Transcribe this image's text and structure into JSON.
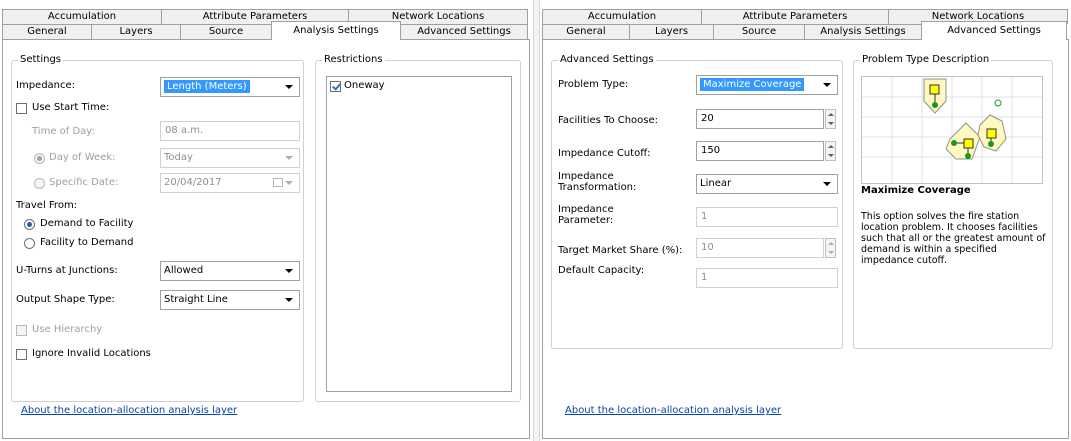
{
  "left": {
    "tabs_row1": [
      "Accumulation",
      "Attribute Parameters",
      "Network Locations"
    ],
    "tabs_row2": [
      "General",
      "Layers",
      "Source",
      "Analysis Settings",
      "Advanced Settings"
    ],
    "active_tab": "Analysis Settings",
    "settings_legend": "Settings",
    "impedance_label": "Impedance:",
    "impedance_value": "Length (Meters)",
    "use_start_time_label": "Use Start Time:",
    "time_of_day_label": "Time of Day:",
    "time_of_day_value": "08 a.m.",
    "day_of_week_label": "Day of Week:",
    "day_of_week_value": "Today",
    "specific_date_label": "Specific Date:",
    "specific_date_value": "20/04/2017",
    "travel_from_label": "Travel From:",
    "demand_to_facility": "Demand to Facility",
    "facility_to_demand": "Facility to Demand",
    "uturns_label": "U-Turns at Junctions:",
    "uturns_value": "Allowed",
    "output_shape_label": "Output Shape Type:",
    "output_shape_value": "Straight Line",
    "use_hierarchy_label": "Use Hierarchy",
    "ignore_invalid_label": "Ignore Invalid Locations",
    "restrictions_legend": "Restrictions",
    "restrictions_items": [
      {
        "label": "Oneway",
        "checked": true
      }
    ],
    "about_link": "About the location-allocation analysis layer"
  },
  "right": {
    "tabs_row1": [
      "Accumulation",
      "Attribute Parameters",
      "Network Locations"
    ],
    "tabs_row2": [
      "General",
      "Layers",
      "Source",
      "Analysis Settings",
      "Advanced Settings"
    ],
    "active_tab": "Advanced Settings",
    "advanced_legend": "Advanced Settings",
    "problem_type_label": "Problem Type:",
    "problem_type_value": "Maximize Coverage",
    "facilities_label": "Facilities To Choose:",
    "facilities_value": "20",
    "cutoff_label": "Impedance Cutoff:",
    "cutoff_value": "150",
    "transformation_label": "Impedance Transformation:",
    "transformation_value": "Linear",
    "parameter_label": "Impedance Parameter:",
    "parameter_value": "1",
    "target_share_label": "Target Market Share (%):",
    "target_share_value": "10",
    "capacity_label": "Default Capacity:",
    "capacity_value": "1",
    "problem_desc_legend": "Problem Type Description",
    "desc_title": "Maximize Coverage",
    "desc_text": "This option solves the fire station location problem. It chooses facilities such that all or the greatest amount of demand is within a specified impedance cutoff.",
    "about_link": "About the location-allocation analysis layer"
  },
  "colors": {
    "selection": "#3399ff",
    "link": "#0645ad",
    "diagram_fill": "#fff8c0",
    "facility": "#ffff00",
    "demand": "#1a9a1a"
  }
}
